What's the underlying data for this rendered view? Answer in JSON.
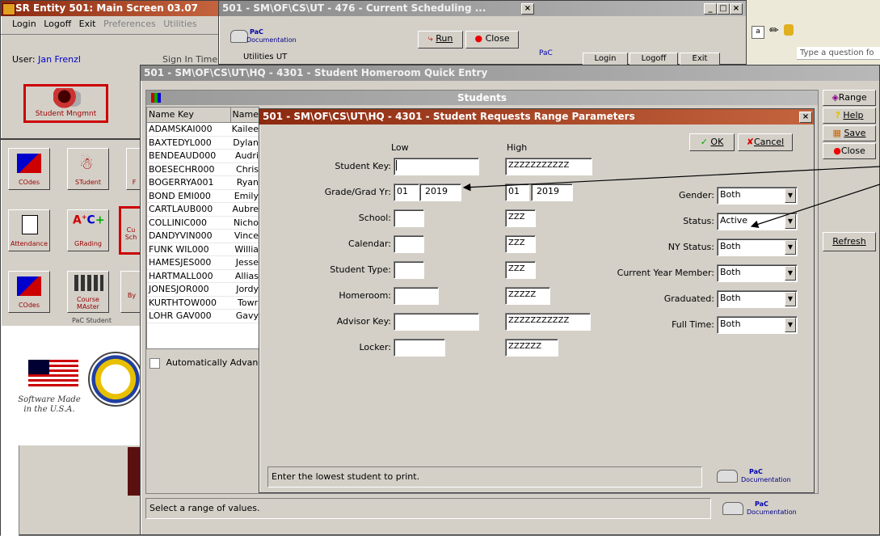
{
  "main_window": {
    "title": "SR Entity 501: Main Screen 03.07",
    "menu": [
      "Login",
      "Logoff",
      "Exit",
      "Preferences",
      "Utilities"
    ],
    "user_label": "User:",
    "user_name": "Jan Frenzl",
    "sign_in_label": "Sign In Time",
    "student_mgmt_label": "Student Mngmnt",
    "icons_row1": [
      "COdes",
      "STudent",
      "F"
    ],
    "icons_row2": [
      "Attendance",
      "GRading",
      "Cu Sch"
    ],
    "icons_row3": [
      "COdes",
      "Course MAster",
      "By"
    ],
    "pac_student_label": "PaC Student",
    "software_made": "Software Made",
    "in_usa": "in the U.S.A."
  },
  "scheduling_window": {
    "title": "501 - SM\\OF\\CS\\UT - 476 - Current Scheduling ...",
    "run_label": "Run",
    "close_label": "Close",
    "pac_doc_label": "PaC Documentation",
    "utilities_label": "Utilities",
    "ut_label": "UT"
  },
  "right_toolbar": {
    "login_label": "Login",
    "logoff_label": "Logoff",
    "exit_label": "Exit",
    "question_placeholder": "Type a question fo",
    "pac_label": "PaC"
  },
  "homeroom_window": {
    "title": "501 - SM\\OF\\CS\\UT\\HQ - 4301 - Student Homeroom Quick Entry",
    "students_header": "Students",
    "columns": [
      "Name Key",
      "Name"
    ],
    "rows": [
      {
        "key": "ADAMSKAI000",
        "name": "Kailee"
      },
      {
        "key": "BAXTEDYL000",
        "name": "Dylan"
      },
      {
        "key": "BENDEAUD000",
        "name": "Audri"
      },
      {
        "key": "BOESECHR000",
        "name": "Chris"
      },
      {
        "key": "BOGERRYA001",
        "name": "Ryan"
      },
      {
        "key": "BOND EMI000",
        "name": "Emily"
      },
      {
        "key": "CARTLAUB000",
        "name": "Aubre"
      },
      {
        "key": "COLLINIC000",
        "name": "Nicho"
      },
      {
        "key": "DANDYVIN000",
        "name": "Vince"
      },
      {
        "key": "FUNK WIL000",
        "name": "Willia"
      },
      {
        "key": "HAMESJES000",
        "name": "Jesse"
      },
      {
        "key": "HARTMALL000",
        "name": "Allias"
      },
      {
        "key": "JONESJOR000",
        "name": "Jordy"
      },
      {
        "key": "KURTHTOW000",
        "name": "Towr"
      },
      {
        "key": "LOHR GAV000",
        "name": "Gavy"
      }
    ],
    "auto_advance_label": "Automatically Advanc",
    "status_text": "Select a range of values.",
    "side_buttons": [
      "Range",
      "Help",
      "Save",
      "Close",
      "Refresh"
    ]
  },
  "range_dialog": {
    "title": "501 - SM\\OF\\CS\\UT\\HQ - 4301 - Student Requests Range Parameters",
    "low_header": "Low",
    "high_header": "High",
    "ok_label": "OK",
    "cancel_label": "Cancel",
    "fields": [
      {
        "label": "Student Key:",
        "low": "",
        "high": "ZZZZZZZZZZZ"
      },
      {
        "label": "Grade/Grad Yr:",
        "low_grade": "01",
        "low_year": "2019",
        "high_grade": "01",
        "high_year": "2019"
      },
      {
        "label": "School:",
        "low": "",
        "high": "ZZZ"
      },
      {
        "label": "Calendar:",
        "low": "",
        "high": "ZZZ"
      },
      {
        "label": "Student Type:",
        "low": "",
        "high": "ZZZ"
      },
      {
        "label": "Homeroom:",
        "low": "",
        "high": "ZZZZZ"
      },
      {
        "label": "Advisor Key:",
        "low": "",
        "high": "ZZZZZZZZZZZ"
      },
      {
        "label": "Locker:",
        "low": "",
        "high": "ZZZZZZ"
      }
    ],
    "dropdowns": [
      {
        "label": "Gender:",
        "value": "Both"
      },
      {
        "label": "Status:",
        "value": "Active"
      },
      {
        "label": "NY Status:",
        "value": "Both"
      },
      {
        "label": "Current Year Member:",
        "value": "Both"
      },
      {
        "label": "Graduated:",
        "value": "Both"
      },
      {
        "label": "Full Time:",
        "value": "Both"
      }
    ],
    "status_text": "Enter the lowest student to print.",
    "pac_doc_label": "PaC Documentation"
  }
}
